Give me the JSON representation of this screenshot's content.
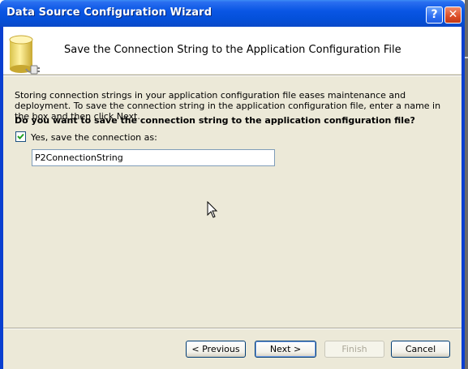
{
  "window": {
    "title": "Data Source Configuration Wizard",
    "help_symbol": "?",
    "close_symbol": "✕"
  },
  "header": {
    "title": "Save the Connection String to the Application Configuration File",
    "icon": "database-connection-icon"
  },
  "body": {
    "description": "Storing connection strings in your application configuration file eases maintenance and deployment. To save the connection string in the application configuration file, enter a name in the box and then click Next.",
    "question": "Do you want to save the connection string to the application configuration file?",
    "save_checkbox": {
      "label": "Yes, save the connection as:",
      "checked": true
    },
    "connection_name": {
      "value": "P2ConnectionString"
    }
  },
  "buttons": {
    "previous": "< Previous",
    "next": "Next >",
    "finish": "Finish",
    "cancel": "Cancel"
  },
  "colors": {
    "titlebar": "#0a56e4",
    "dialog_bg": "#ece9d8",
    "header_bg": "#ffffff",
    "checkmark": "#21a121"
  }
}
